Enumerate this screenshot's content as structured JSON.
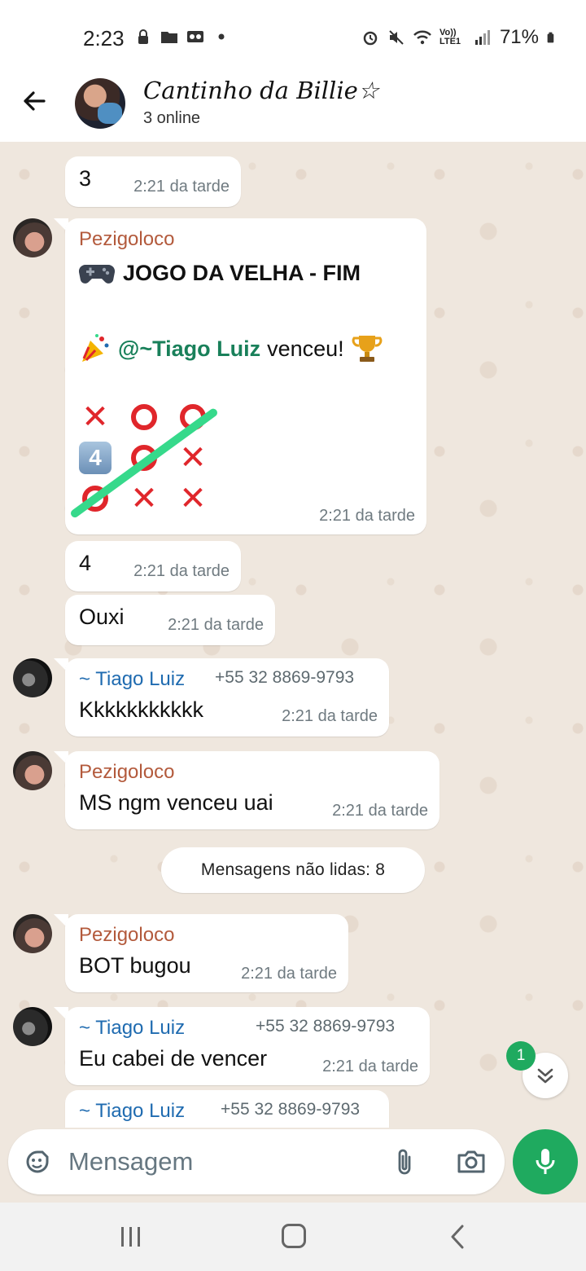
{
  "status_bar": {
    "time": "2:23",
    "battery": "71%",
    "network": "Vo)) LTE1",
    "icons": [
      "lock-icon",
      "folder-icon",
      "voicemail-icon",
      "dot-icon",
      "alarm-icon",
      "mute-icon",
      "wifi-icon",
      "signal-icon",
      "battery-icon"
    ]
  },
  "header": {
    "title": "Cantinho da Billie☆",
    "subtitle": "3 online"
  },
  "messages": {
    "m1": {
      "text": "3",
      "time": "2:21 da tarde"
    },
    "m2": {
      "sender": "Pezigoloco",
      "title": "JOGO DA VELHA - FIM",
      "mention": "@~Tiago Luiz",
      "win_text": "venceu!",
      "board": [
        [
          "X",
          "O",
          "O"
        ],
        [
          "4",
          "O",
          "X"
        ],
        [
          "O",
          "X",
          "X"
        ]
      ],
      "time": "2:21 da tarde"
    },
    "m3": {
      "text": "4",
      "time": "2:21 da tarde"
    },
    "m4": {
      "text": "Ouxi",
      "time": "2:21 da tarde"
    },
    "m5": {
      "sender": "~ Tiago Luiz",
      "phone": "+55 32 8869-9793",
      "text": "Kkkkkkkkkkk",
      "time": "2:21 da tarde"
    },
    "m6": {
      "sender": "Pezigoloco",
      "text": "MS ngm venceu uai",
      "time": "2:21 da tarde"
    },
    "unread_divider": "Mensagens não lidas: 8",
    "m7": {
      "sender": "Pezigoloco",
      "text": "BOT bugou",
      "time": "2:21 da tarde"
    },
    "m8": {
      "sender": "~ Tiago Luiz",
      "phone": "+55 32 8869-9793",
      "text": "Eu cabei de vencer",
      "time": "2:21 da tarde"
    },
    "m9": {
      "sender": "~ Tiago Luiz",
      "phone": "+55 32 8869-9793"
    }
  },
  "scroll_badge": "1",
  "input": {
    "placeholder": "Mensagem"
  },
  "colors": {
    "accent": "#1faa5f",
    "sender_orange": "#b35a3c",
    "sender_blue": "#1f6bb0",
    "strike": "#36d98b",
    "game_red": "#e0262b"
  }
}
